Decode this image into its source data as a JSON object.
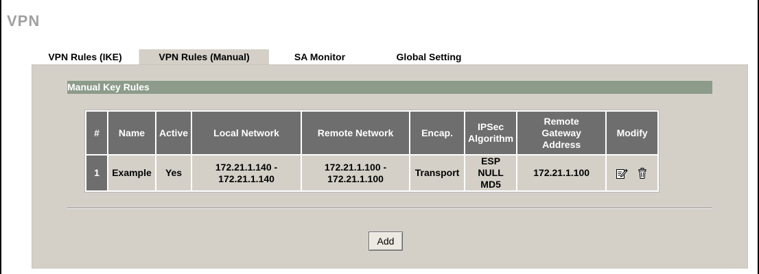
{
  "page": {
    "title": "VPN"
  },
  "tabs": [
    {
      "label": "VPN Rules (IKE)",
      "active": false
    },
    {
      "label": "VPN Rules (Manual)",
      "active": true
    },
    {
      "label": "SA Monitor",
      "active": false
    },
    {
      "label": "Global Setting",
      "active": false
    }
  ],
  "section": {
    "title": "Manual Key Rules"
  },
  "table": {
    "headers": {
      "num": "#",
      "name": "Name",
      "active": "Active",
      "local": "Local Network",
      "remote": "Remote Network",
      "encap": "Encap.",
      "ipsec_1": "IPSec",
      "ipsec_2": "Algorithm",
      "gw_1": "Remote",
      "gw_2": "Gateway",
      "gw_3": "Address",
      "modify": "Modify"
    },
    "rows": [
      {
        "num": "1",
        "name": "Example",
        "active": "Yes",
        "local_1": "172.21.1.140 -",
        "local_2": "172.21.1.140",
        "remote_1": "172.21.1.100 -",
        "remote_2": "172.21.1.100",
        "encap": "Transport",
        "algo_1": "ESP NULL",
        "algo_2": "MD5",
        "gateway": "172.21.1.100",
        "edit_icon": "edit-icon",
        "delete_icon": "trash-icon"
      }
    ]
  },
  "buttons": {
    "add": "Add"
  },
  "colors": {
    "panel": "#d4d0c8",
    "section_bar": "#8c9b8a",
    "header_cell": "#6e6e6e",
    "title": "#a0a0a0"
  }
}
